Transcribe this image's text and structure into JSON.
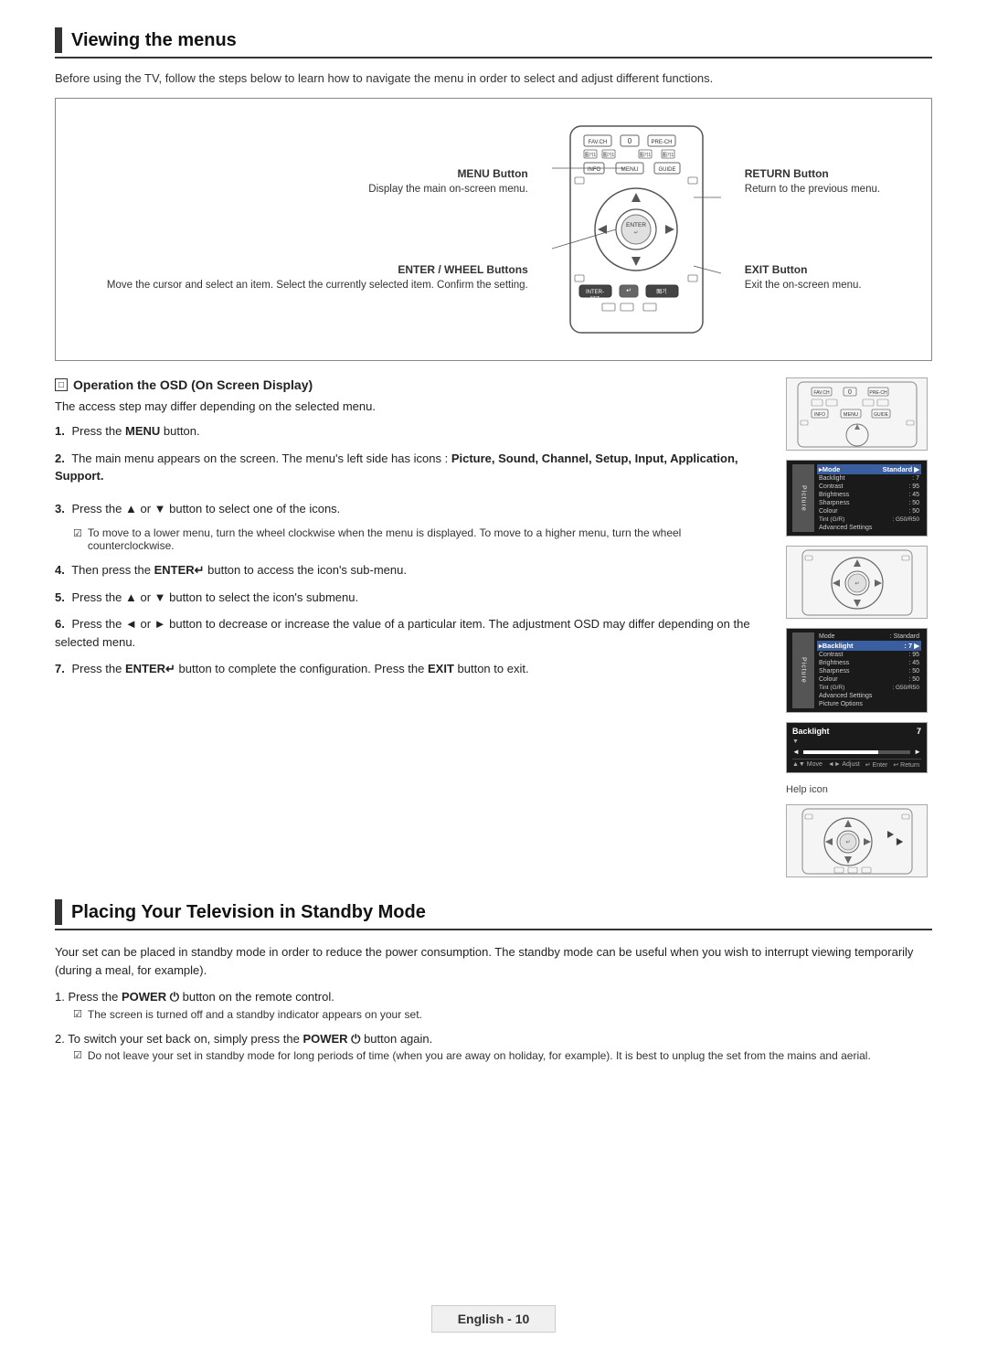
{
  "page": {
    "title": "Viewing the menus",
    "intro": "Before using the TV, follow the steps below to learn how to navigate the menu in order to select and adjust different functions."
  },
  "diagram": {
    "menu_button_label": "MENU Button",
    "menu_button_desc": "Display the main on-screen menu.",
    "enter_label": "ENTER / WHEEL Buttons",
    "enter_desc": "Move the cursor and select an item. Select the currently selected item. Confirm the setting.",
    "return_label": "RETURN Button",
    "return_desc": "Return to the previous menu.",
    "exit_label": "EXIT Button",
    "exit_desc": "Exit the on-screen menu."
  },
  "osd": {
    "title": "Operation the OSD (On Screen Display)",
    "subtitle": "The access step may differ depending on the selected menu.",
    "steps": [
      {
        "num": "1.",
        "text": "Press the MENU button."
      },
      {
        "num": "2.",
        "text": "The main menu appears on the screen. The menu's left side has icons : Picture, Sound, Channel, Setup, Input, Application, Support."
      },
      {
        "num": "3.",
        "text": "Press the ▲ or ▼ button to select one of the icons."
      },
      {
        "num": "4.",
        "text": "Then press the ENTER button to access the icon's sub-menu."
      },
      {
        "num": "5.",
        "text": "Press the ▲ or ▼ button to select the icon's submenu."
      },
      {
        "num": "6.",
        "text": "Press the ◄ or ► button to decrease or increase the value of a particular item. The adjustment OSD may differ depending on the selected menu."
      },
      {
        "num": "7.",
        "text": "Press the ENTER button to complete the configuration. Press the EXIT button to exit."
      }
    ],
    "note3": "To move to a lower menu, turn the wheel clockwise when the menu is displayed. To move to a higher menu, turn the wheel counterclockwise.",
    "menu_items": [
      {
        "label": "Mode",
        "value": ": Standard",
        "selected": true
      },
      {
        "label": "Backlight",
        "value": ": 7"
      },
      {
        "label": "Contrast",
        "value": ": 95"
      },
      {
        "label": "Brightness",
        "value": ": 45"
      },
      {
        "label": "Sharpness",
        "value": ": 50"
      },
      {
        "label": "Colour",
        "value": ": 50"
      },
      {
        "label": "Tint (G/R)",
        "value": ": G50/R50"
      },
      {
        "label": "Advanced Settings",
        "value": ""
      }
    ],
    "menu_items2": [
      {
        "label": "Mode",
        "value": ": Standard"
      },
      {
        "label": "Backlight",
        "value": ": 7",
        "selected": true
      },
      {
        "label": "Contrast",
        "value": ": 95"
      },
      {
        "label": "Brightness",
        "value": ": 45"
      },
      {
        "label": "Sharpness",
        "value": ": 50"
      },
      {
        "label": "Colour",
        "value": ": 50"
      },
      {
        "label": "Tint (G/R)",
        "value": ": G50/R50"
      },
      {
        "label": "Advanced Settings",
        "value": ""
      },
      {
        "label": "Picture Options",
        "value": ""
      }
    ],
    "help_icon_label": "Help icon",
    "backlight_value": "7"
  },
  "standby": {
    "title": "Placing Your Television in Standby Mode",
    "intro": "Your set can be placed in standby mode in order to reduce the power consumption. The standby mode can be useful when you wish to interrupt viewing temporarily (during a meal, for example).",
    "steps": [
      {
        "num": "1.",
        "text": "Press the POWER button on the remote control."
      },
      {
        "num": "2.",
        "text": "To switch your set back on, simply press the POWER button again."
      }
    ],
    "note1": "The screen is turned off and a standby indicator appears on your set.",
    "note2": "Do not leave your set in standby mode for long periods of time (when you are away on holiday, for example). It is best to unplug the set from the mains and aerial."
  },
  "footer": {
    "label": "English - 10"
  }
}
